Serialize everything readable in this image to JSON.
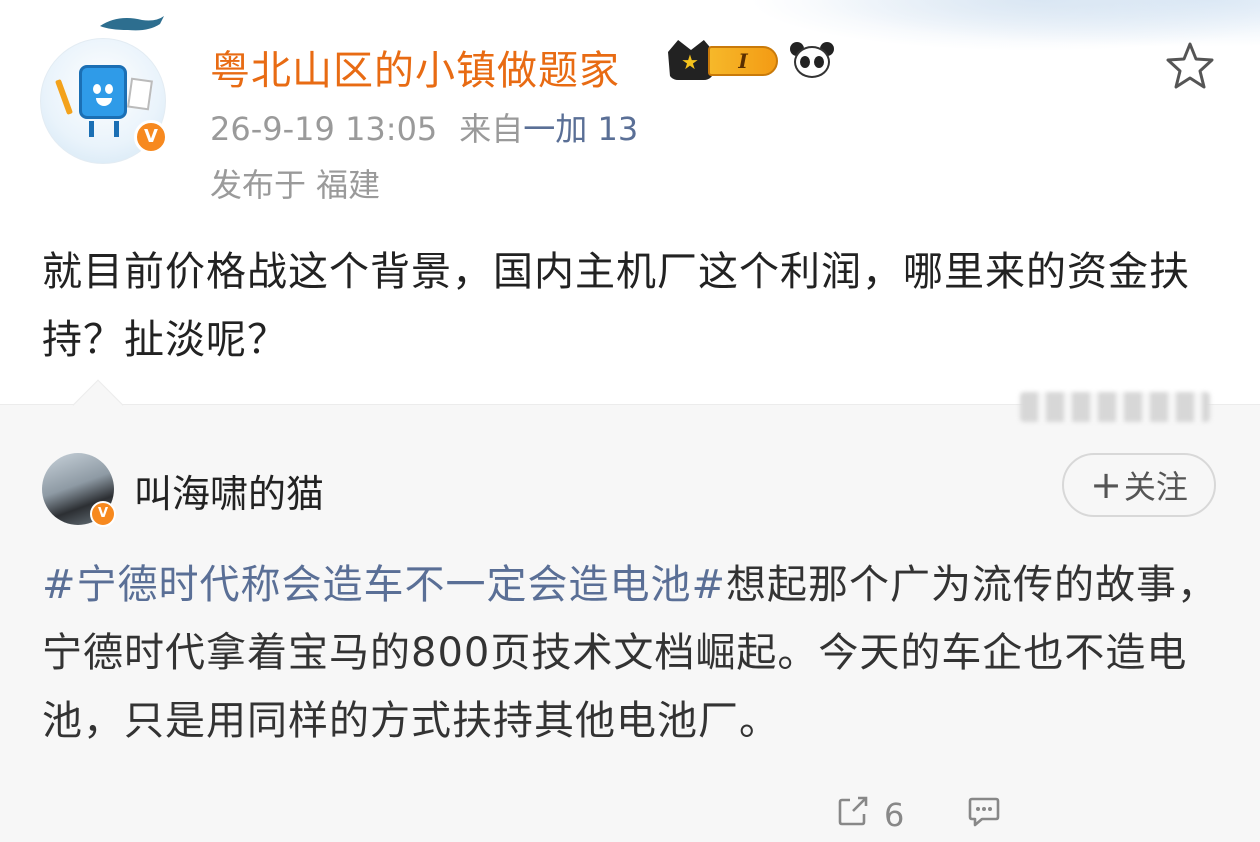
{
  "post": {
    "username": "粤北山区的小镇做题家",
    "level_badge": "I",
    "time": "26-9-19 13:05",
    "source_prefix": "来自",
    "source": "一加 13",
    "location": "发布于 福建",
    "text": "就目前价格战这个背景，国内主机厂这个利润，哪里来的资金扶持？扯淡呢？",
    "verified_mark": "V"
  },
  "repost": {
    "username": "叫海啸的猫",
    "verified_mark": "V",
    "follow_label": "关注",
    "follow_plus": "+",
    "hashtag": "#宁德时代称会造车不一定会造电池#",
    "text": "想起那个广为流传的故事，宁德时代拿着宝马的800页技术文档崛起。今天的车企也不造电池，只是用同样的方式扶持其他电池厂。",
    "repost_count": "6"
  },
  "icons": {
    "favorite": "star-outline-icon",
    "share": "share-icon",
    "comment": "comment-icon"
  },
  "colors": {
    "username": "#e86b13",
    "link": "#5a6f96",
    "verified": "#f7891f"
  }
}
